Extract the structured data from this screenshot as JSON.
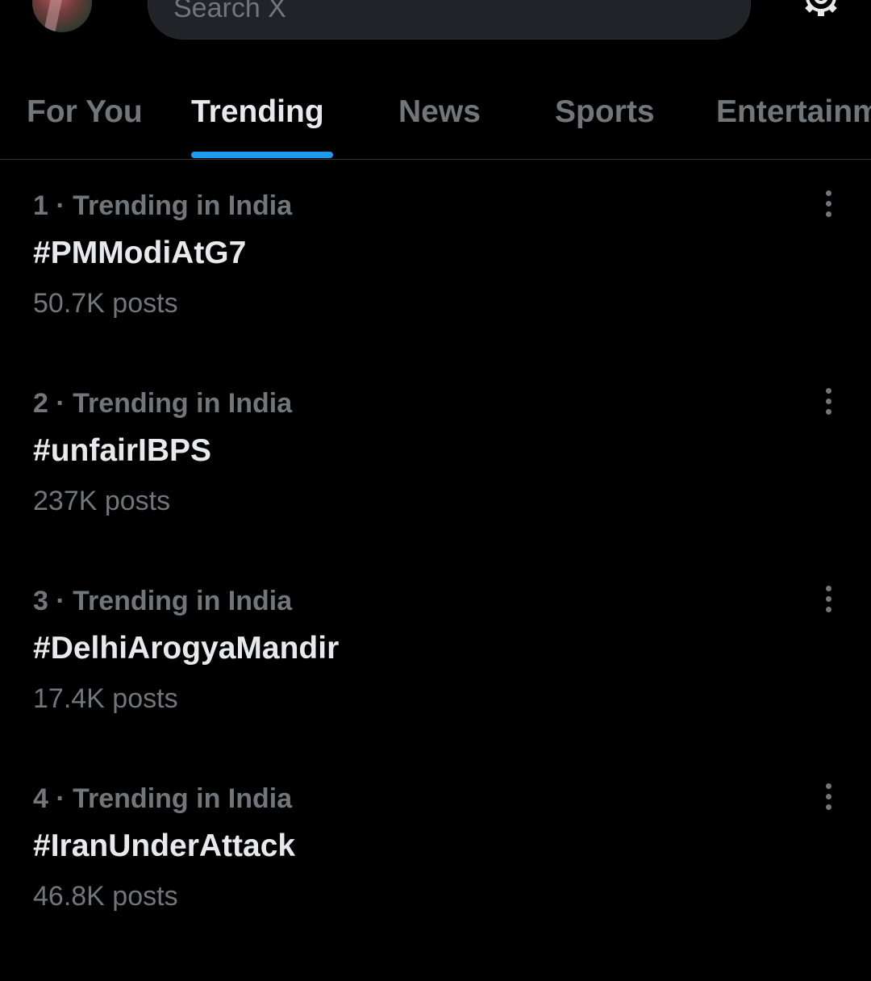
{
  "header": {
    "search_placeholder": "Search X",
    "avatar_icon": "profile-avatar",
    "settings_icon": "gear-icon"
  },
  "tabs": [
    {
      "label": "For You",
      "active": false
    },
    {
      "label": "Trending",
      "active": true
    },
    {
      "label": "News",
      "active": false
    },
    {
      "label": "Sports",
      "active": false
    },
    {
      "label": "Entertainment",
      "active": false
    }
  ],
  "trends": [
    {
      "meta": "1 · Trending in India",
      "name": "#PMModiAtG7",
      "count": "50.7K posts"
    },
    {
      "meta": "2 · Trending in India",
      "name": "#unfairIBPS",
      "count": "237K posts"
    },
    {
      "meta": "3 · Trending in India",
      "name": "#DelhiArogyaMandir",
      "count": "17.4K posts"
    },
    {
      "meta": "4 · Trending in India",
      "name": "#IranUnderAttack",
      "count": "46.8K posts"
    }
  ],
  "colors": {
    "background": "#000000",
    "text_primary": "#e7e9ea",
    "text_secondary": "#71767b",
    "accent": "#1d9bf0",
    "search_bg": "#202327"
  }
}
